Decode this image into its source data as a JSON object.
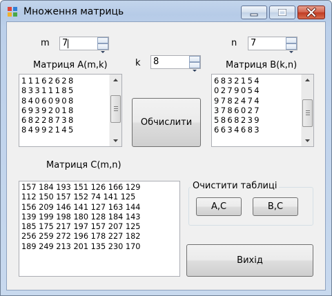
{
  "window": {
    "title": "Множення матриць",
    "accent_color": "#b9cde7",
    "close_color": "#c84b30"
  },
  "params": {
    "m_label": "m",
    "m_value": "7",
    "n_label": "n",
    "n_value": "7",
    "k_label": "k",
    "k_value": "8"
  },
  "matrix_a": {
    "label": "Матриця A(m,k)",
    "rows": [
      "11162628",
      "83311185",
      "84060908",
      "69392018",
      "68228738",
      "84992145"
    ]
  },
  "matrix_b": {
    "label": "Матриця B(k,n)",
    "rows": [
      "6832154",
      "0279054",
      "9782474",
      "3786027",
      "5868239",
      "6634683"
    ]
  },
  "matrix_c": {
    "label": "Матриця C(m,n)",
    "rows": [
      "157 184 193 151 126 166 129",
      "112 150 157 152 74 141 125",
      "156 209 146 141 127 163 144",
      "139 199 198 180 128 184 143",
      "185 175 217 197 157 207 125",
      "256 259 272 196 178 227 182",
      "189 249 213 201 135 230 170"
    ]
  },
  "buttons": {
    "compute": "Обчислити",
    "clear_group": "Очистити таблиці",
    "clear_ac": "A,C",
    "clear_bc": "B,C",
    "exit": "Вихід"
  },
  "icons": {
    "app": "windows-forms-app-icon",
    "minimize": "minimize-icon",
    "maximize": "maximize-icon",
    "close": "close-icon",
    "spin_up": "arrow-up-icon",
    "spin_down": "arrow-down-icon"
  }
}
